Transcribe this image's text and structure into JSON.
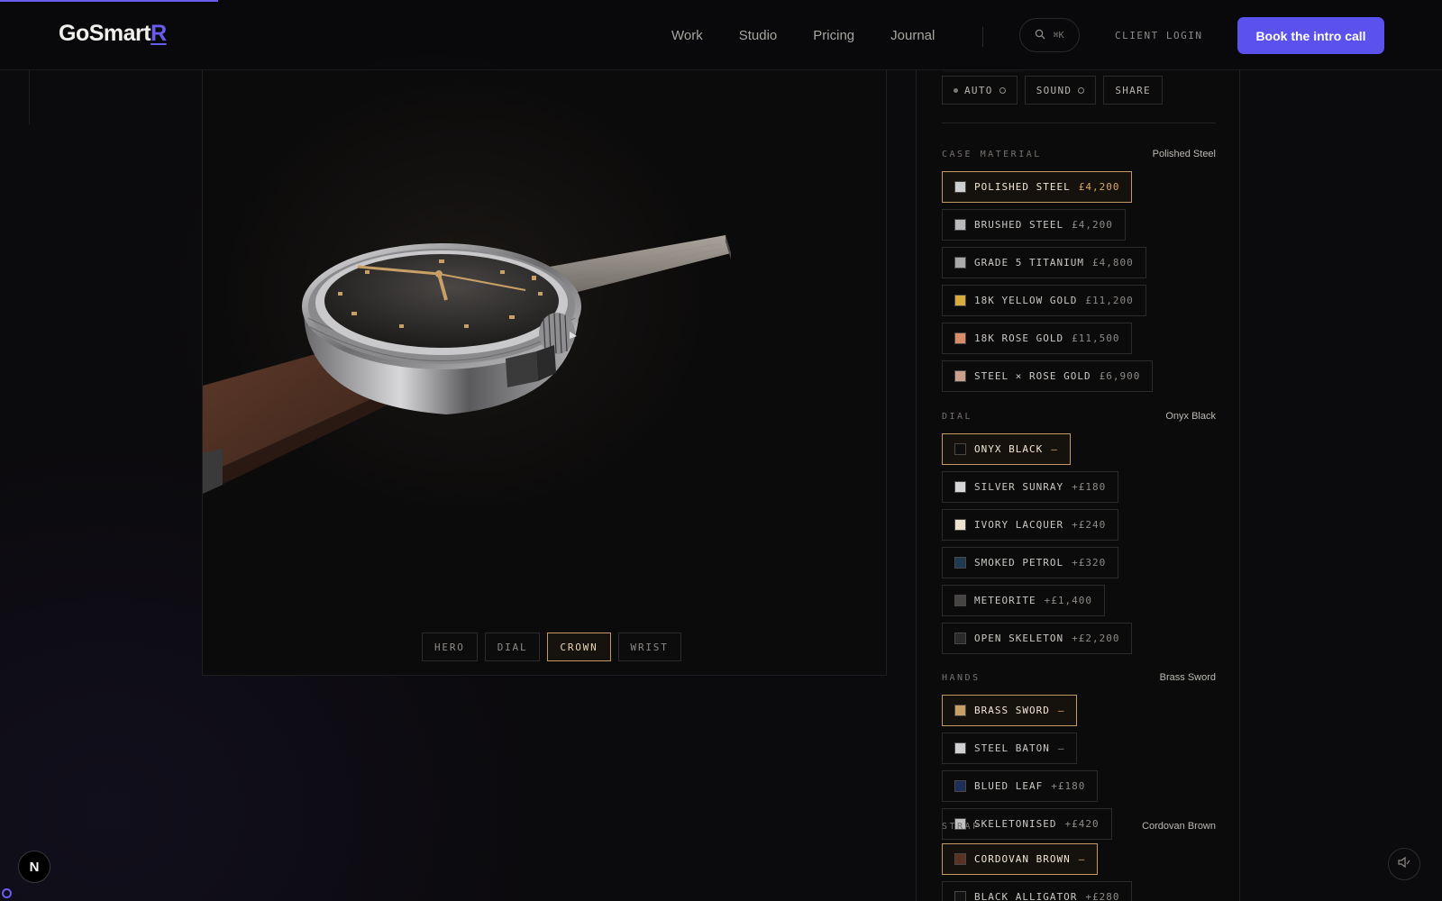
{
  "header": {
    "logo_main": "GoSmart",
    "logo_accent": "R",
    "nav": [
      "Work",
      "Studio",
      "Pricing",
      "Journal"
    ],
    "search_shortcut": "⌘K",
    "client_login": "CLIENT LOGIN",
    "cta": "Book the intro call"
  },
  "viewer": {
    "tabs": [
      "HERO",
      "DIAL",
      "CROWN",
      "WRIST"
    ],
    "active_tab": "CROWN"
  },
  "panel": {
    "toggles": {
      "auto": "AUTO",
      "sound": "SOUND",
      "share": "SHARE"
    },
    "case": {
      "label": "CASE MATERIAL",
      "value": "Polished Steel",
      "options": [
        {
          "name": "POLISHED STEEL",
          "price": "£4,200",
          "color": "#cfd0d2",
          "selected": true
        },
        {
          "name": "BRUSHED STEEL",
          "price": "£4,200",
          "color": "#b9babc",
          "selected": false
        },
        {
          "name": "GRADE 5 TITANIUM",
          "price": "£4,800",
          "color": "#a9a9a9",
          "selected": false
        },
        {
          "name": "18K YELLOW GOLD",
          "price": "£11,200",
          "color": "#d7ab3e",
          "selected": false
        },
        {
          "name": "18K ROSE GOLD",
          "price": "£11,500",
          "color": "#d98b6a",
          "selected": false
        },
        {
          "name": "STEEL × ROSE GOLD",
          "price": "£6,900",
          "color": "#c9a08c",
          "selected": false
        }
      ]
    },
    "dial": {
      "label": "DIAL",
      "value": "Onyx Black",
      "options": [
        {
          "name": "ONYX BLACK",
          "price": "—",
          "color": "#0e0e0e",
          "selected": true
        },
        {
          "name": "SILVER SUNRAY",
          "price": "+£180",
          "color": "#d6d6d8",
          "selected": false
        },
        {
          "name": "IVORY LACQUER",
          "price": "+£240",
          "color": "#ece3cf",
          "selected": false
        },
        {
          "name": "SMOKED PETROL",
          "price": "+£320",
          "color": "#1d3a52",
          "selected": false
        },
        {
          "name": "METEORITE",
          "price": "+£1,400",
          "color": "#454443",
          "selected": false
        },
        {
          "name": "OPEN SKELETON",
          "price": "+£2,200",
          "color": "#2a2a2a",
          "selected": false
        }
      ]
    },
    "hands": {
      "label": "HANDS",
      "value": "Brass Sword",
      "options": [
        {
          "name": "BRASS SWORD",
          "price": "—",
          "color": "#c8a066",
          "selected": true
        },
        {
          "name": "STEEL BATON",
          "price": "—",
          "color": "#cfd0d2",
          "selected": false
        },
        {
          "name": "BLUED LEAF",
          "price": "+£180",
          "color": "#1c2e5a",
          "selected": false
        },
        {
          "name": "SKELETONISED",
          "price": "+£420",
          "color": "#bfc0c2",
          "selected": false
        }
      ]
    },
    "strap": {
      "label": "STRAP",
      "value": "Cordovan Brown",
      "options": [
        {
          "name": "CORDOVAN BROWN",
          "price": "—",
          "color": "#5a3222",
          "selected": true
        },
        {
          "name": "BLACK ALLIGATOR",
          "price": "+£280",
          "color": "#121212",
          "selected": false
        }
      ]
    }
  },
  "corner": {
    "next_badge": "N"
  },
  "colors": {
    "accent": "#5b52ee",
    "gold_selected": "#c29a62"
  }
}
